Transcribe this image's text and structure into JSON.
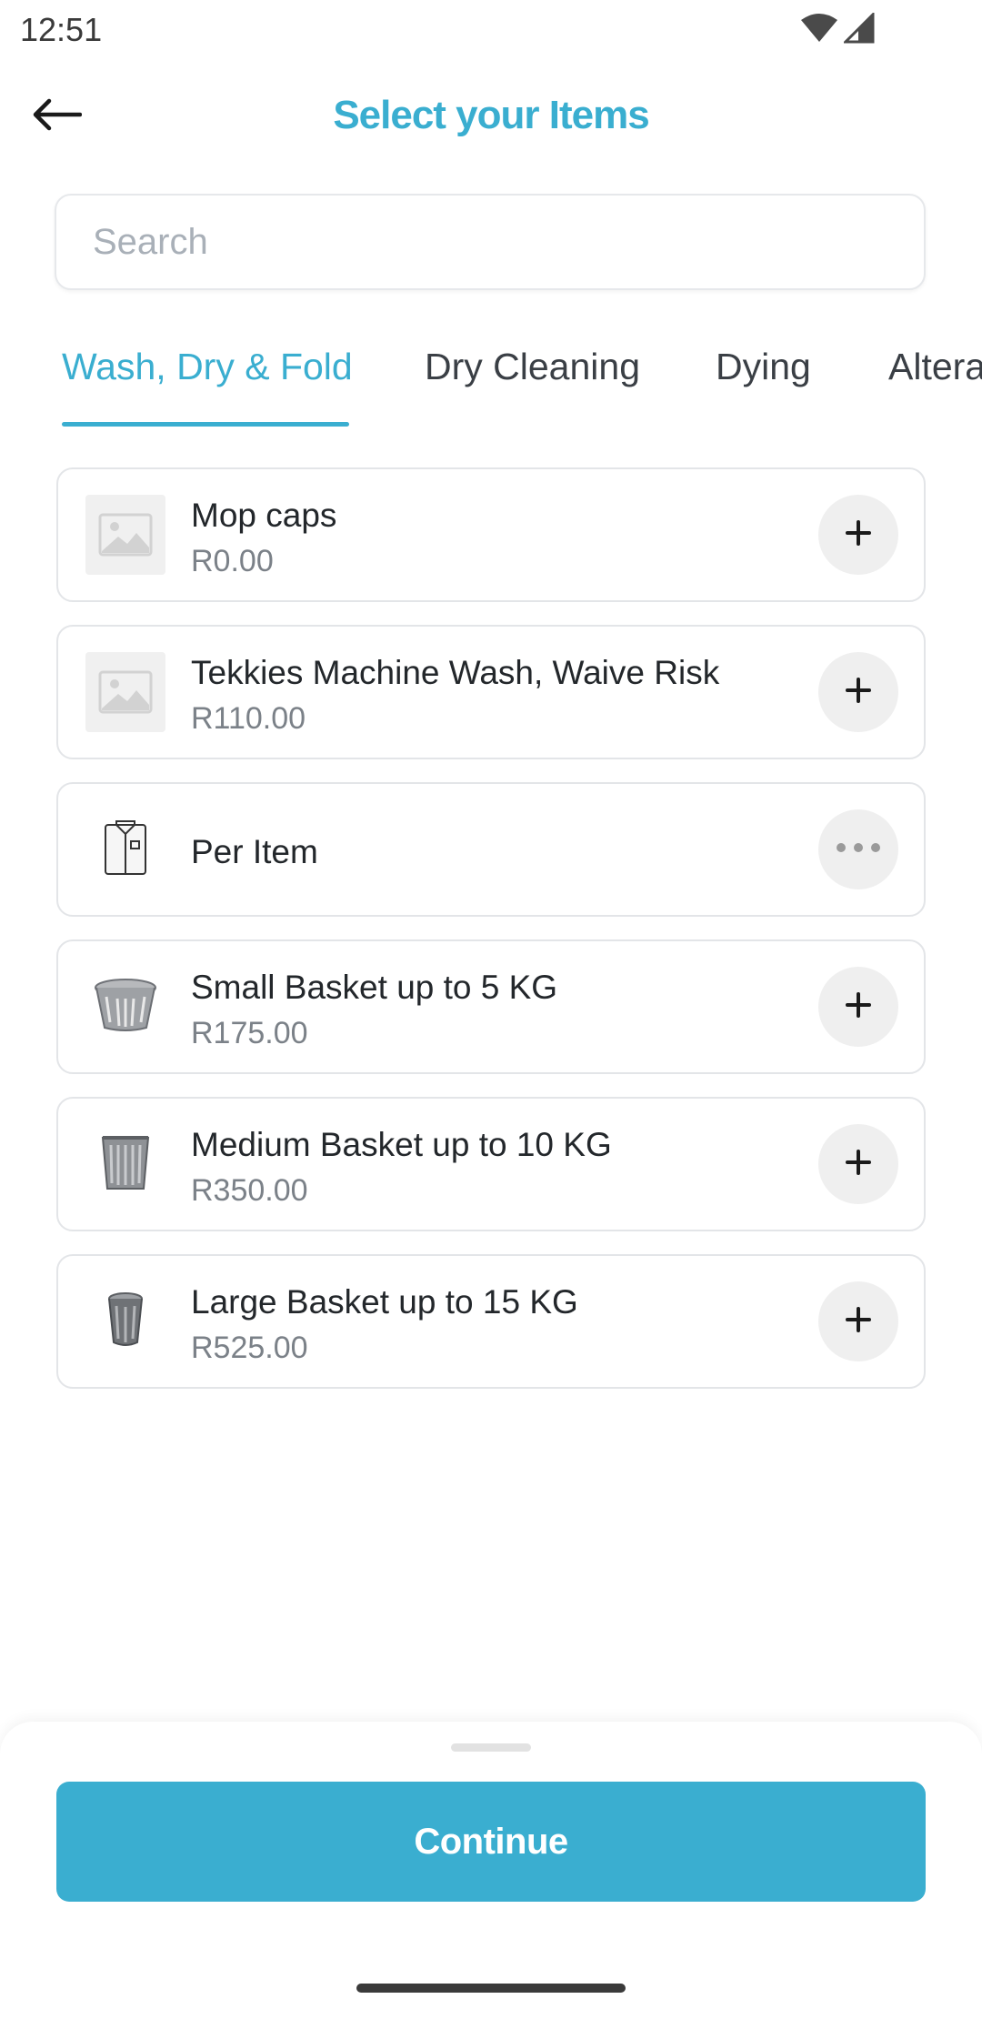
{
  "status_bar": {
    "time": "12:51",
    "icons": [
      "wifi-icon",
      "signal-icon"
    ]
  },
  "header": {
    "title": "Select your Items",
    "back_icon": "arrow-left-icon"
  },
  "search": {
    "placeholder": "Search",
    "value": ""
  },
  "tabs": [
    {
      "label": "Wash, Dry & Fold",
      "active": true
    },
    {
      "label": "Dry Cleaning",
      "active": false
    },
    {
      "label": "Dying",
      "active": false
    },
    {
      "label": "Altera",
      "active": false
    }
  ],
  "items": [
    {
      "name": "Mop caps",
      "price": "R0.00",
      "thumb": "image-placeholder-icon",
      "action": "plus-icon"
    },
    {
      "name": "Tekkies Machine Wash, Waive Risk",
      "price": "R110.00",
      "thumb": "image-placeholder-icon",
      "action": "plus-icon"
    },
    {
      "name": "Per Item",
      "price": "",
      "thumb": "shirt-icon",
      "action": "more-icon"
    },
    {
      "name": "Small Basket up to 5 KG",
      "price": "R175.00",
      "thumb": "small-basket-icon",
      "action": "plus-icon"
    },
    {
      "name": "Medium Basket up to 10 KG",
      "price": "R350.00",
      "thumb": "medium-basket-icon",
      "action": "plus-icon"
    },
    {
      "name": "Large Basket up to 15 KG",
      "price": "R525.00",
      "thumb": "large-basket-icon",
      "action": "plus-icon"
    }
  ],
  "footer": {
    "continue_label": "Continue"
  },
  "colors": {
    "accent": "#3aaed0",
    "text": "#23272b",
    "price": "#7b8188"
  }
}
